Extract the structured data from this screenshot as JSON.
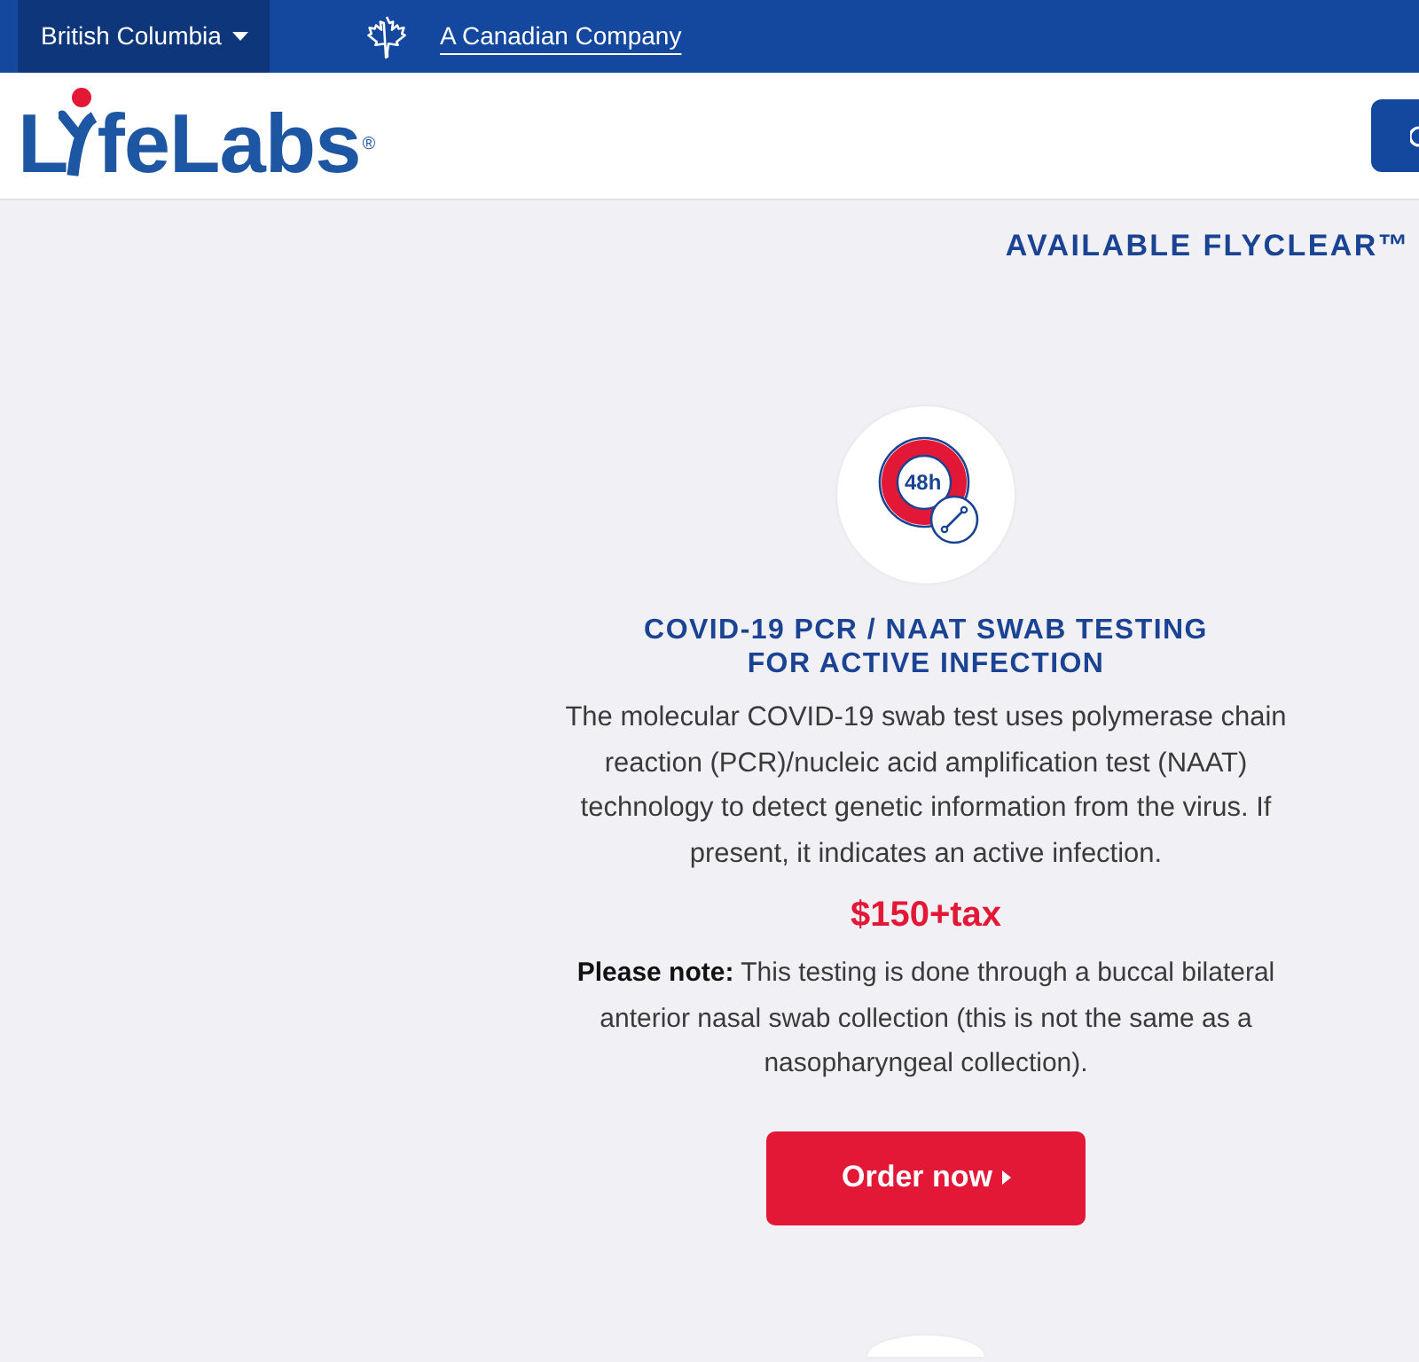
{
  "top_bar": {
    "region": "British Columbia",
    "tagline_link": "A Canadian Company"
  },
  "header": {
    "logo": {
      "first_letter": "L",
      "rest": "feLabs",
      "mark": "®"
    }
  },
  "banner": {
    "heading": "AVAILABLE FLYCLEAR™"
  },
  "service": {
    "icon_label": "48h",
    "title": "COVID-19 PCR / NAAT SWAB TESTING FOR ACTIVE INFECTION",
    "description": "The molecular COVID-19 swab test uses polymerase chain reaction (PCR)/nucleic acid amplification test (NAAT) technology to detect genetic information from the virus. If present, it indicates an active infection.",
    "price": "$150+tax",
    "note": "**Please note:** This testing is done through a buccal bilateral anterior nasal swab collection (this is not the same as a nasopharyngeal collection).",
    "button": "Order now"
  }
}
